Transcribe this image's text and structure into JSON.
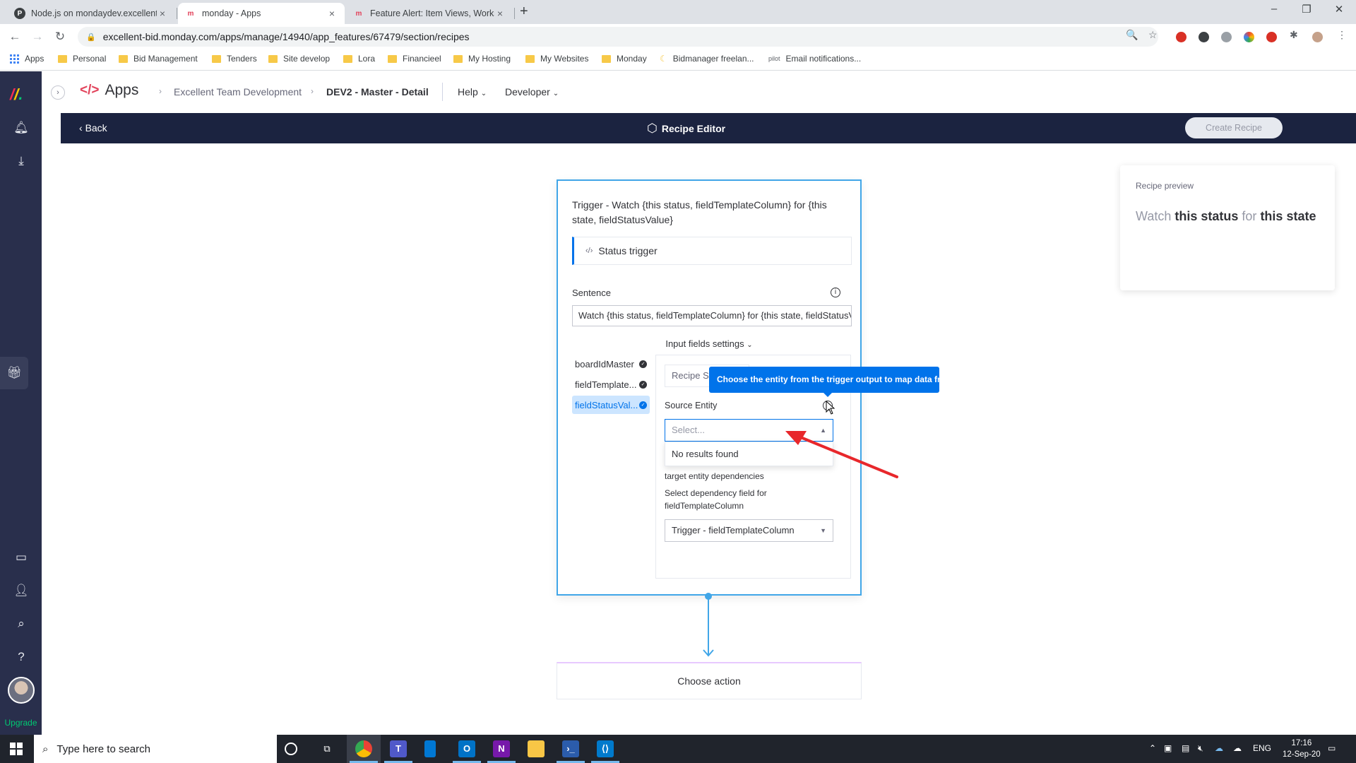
{
  "browser": {
    "tabs": [
      {
        "title": "Node.js on mondaydev.excellent-",
        "icon": "node-icon"
      },
      {
        "title": "monday - Apps",
        "icon": "monday-icon"
      },
      {
        "title": "Feature Alert: Item Views, Worksp",
        "icon": "monday-icon"
      }
    ],
    "url": "excellent-bid.monday.com/apps/manage/14940/app_features/67479/section/recipes",
    "bookmarks": [
      "Apps",
      "Personal",
      "Bid Management",
      "Tenders",
      "Site develop",
      "Lora",
      "Financieel",
      "My Hosting",
      "My Websites",
      "Monday",
      "Bidmanager freelan...",
      "Email notifications..."
    ]
  },
  "header": {
    "logo": "Apps",
    "breadcrumbs": [
      "Excellent Team Development",
      "DEV2 - Master - Detail"
    ],
    "menus": [
      "Help",
      "Developer"
    ]
  },
  "editor": {
    "back": "Back",
    "title": "Recipe Editor",
    "create": "Create Recipe"
  },
  "trigger": {
    "title": "Trigger - Watch {this status, fieldTemplateColumn} for {this state, fieldStatusValue}",
    "status_trigger": "Status trigger",
    "sentence_label": "Sentence",
    "sentence_value": "Watch {this status, fieldTemplateColumn} for {this state, fieldStatusValue}",
    "input_fields_settings": "Input fields settings",
    "fields": [
      "boardIdMaster",
      "fieldTemplate...",
      "fieldStatusVal..."
    ],
    "recipe_s": "Recipe S",
    "source_entity_label": "Source Entity",
    "select_placeholder": "Select...",
    "no_results": "No results found",
    "dependencies_label": "target entity dependencies",
    "dependency_text": "Select dependency field for fieldTemplateColumn",
    "dependency_value": "Trigger - fieldTemplateColumn",
    "tooltip": "Choose the entity from the trigger output to map data from"
  },
  "action": {
    "label": "Choose action"
  },
  "preview": {
    "label": "Recipe preview",
    "w1": "Watch",
    "b1": "this status",
    "w2": "for",
    "b2": "this state"
  },
  "rail": {
    "upgrade": "Upgrade"
  },
  "taskbar": {
    "search_placeholder": "Type here to search",
    "lang": "ENG",
    "time": "17:16",
    "date": "12-Sep-20"
  },
  "colors": {
    "accent": "#0073ea",
    "editor_bar": "#1b2340",
    "rail": "#292f4c",
    "card_border": "#41a6e8",
    "annotation_arrow": "#e8272b"
  }
}
